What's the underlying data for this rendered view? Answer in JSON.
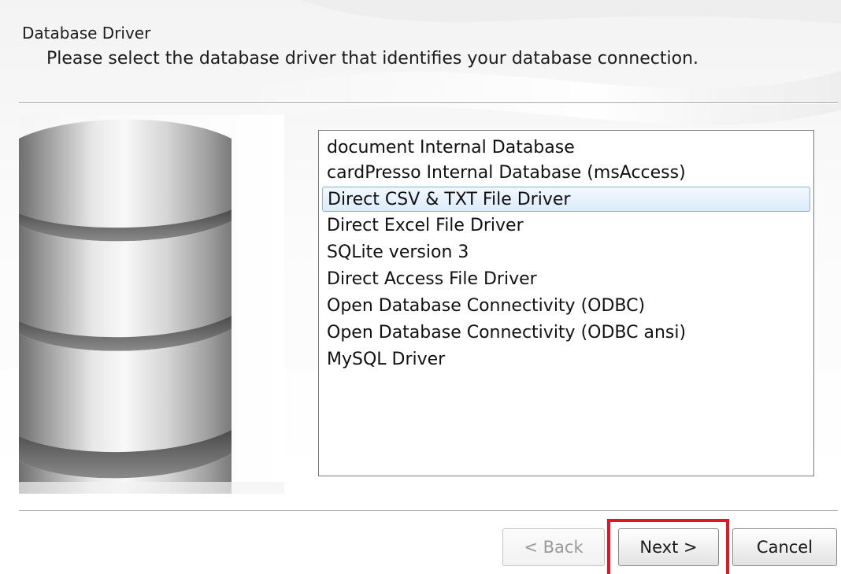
{
  "header": {
    "title": "Database Driver",
    "subtitle": "Please select the database driver that identifies your database connection."
  },
  "drivers": {
    "items": [
      "document Internal Database",
      "cardPresso Internal Database (msAccess)",
      "Direct CSV & TXT File Driver",
      "Direct Excel File Driver",
      "SQLite version 3",
      "Direct Access File Driver",
      "Open Database Connectivity (ODBC)",
      "Open Database Connectivity (ODBC ansi)",
      "MySQL Driver"
    ],
    "selected_index": 2
  },
  "buttons": {
    "back": "< Back",
    "next": "Next >",
    "cancel": "Cancel"
  },
  "colors": {
    "highlight": "#e8141e",
    "selection_border": "#8fb4e0"
  },
  "icons": {
    "graphic": "database-stack-icon"
  }
}
